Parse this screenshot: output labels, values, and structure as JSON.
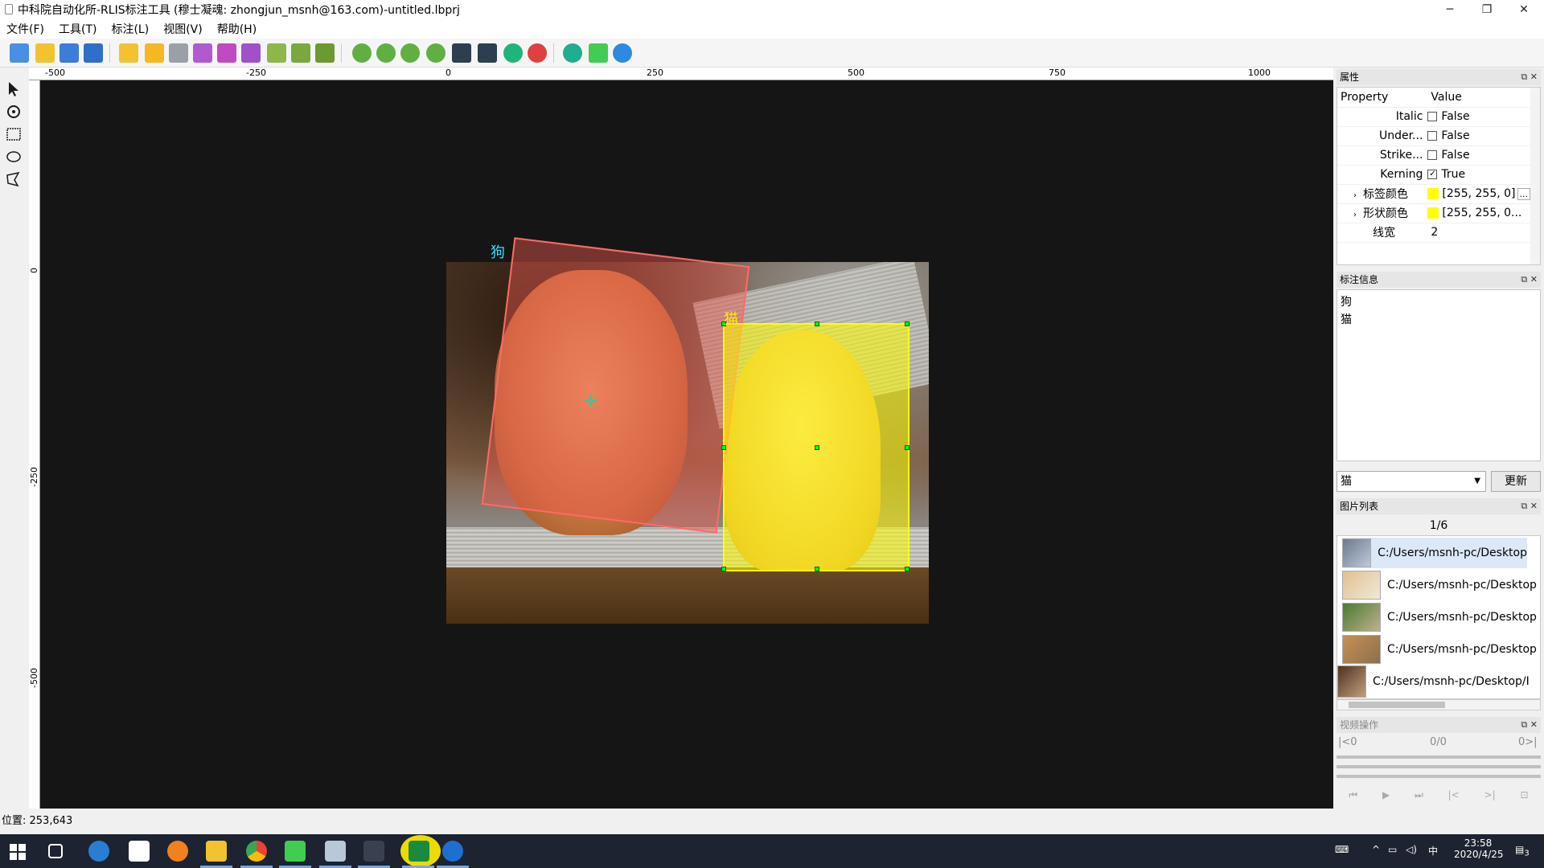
{
  "window": {
    "title": "中科院自动化所-RLIS标注工具 (穆士凝魂: zhongjun_msnh@163.com)-untitled.lbprj",
    "minimize_glyph": "─",
    "restore_glyph": "❐",
    "close_glyph": "✕"
  },
  "menu": [
    "文件(F)",
    "工具(T)",
    "标注(L)",
    "视图(V)",
    "帮助(H)"
  ],
  "toolbar_icons": [
    "new-file-icon",
    "open-file-icon",
    "save-icon",
    "save-as-icon",
    "open-folder-icon",
    "add-folder-icon",
    "export-icon",
    "add-layer-icon",
    "delete-layer-icon",
    "layers-icon",
    "copy-icon",
    "cut-icon",
    "paste-icon",
    "zoom-in-icon",
    "zoom-out-icon",
    "zoom-fit-icon",
    "zoom-1to1-icon",
    "skip-back-icon",
    "skip-forward-icon",
    "play-icon",
    "stop-icon",
    "settings-icon",
    "qt-icon",
    "info-icon"
  ],
  "left_tools": [
    "pointer-icon",
    "rotate-icon",
    "rectangle-icon",
    "ellipse-icon",
    "polygon-icon"
  ],
  "hruler": [
    "-500",
    "-250",
    "0",
    "250",
    "500",
    "750",
    "1000"
  ],
  "vruler": [
    "0",
    "-250",
    "-500"
  ],
  "canvas": {
    "annotations": [
      {
        "label": "狗",
        "color": "#ff6a66",
        "label_color": "#33e0ff"
      },
      {
        "label": "猫",
        "color": "#ffff00",
        "label_color": "#ffee00"
      }
    ],
    "center_marker": "✛"
  },
  "properties_panel": {
    "title": "属性",
    "header_property": "Property",
    "header_value": "Value",
    "rows": [
      {
        "name": "Italic",
        "value": "False",
        "checked": false
      },
      {
        "name": "Under...",
        "value": "False",
        "checked": false
      },
      {
        "name": "Strike...",
        "value": "False",
        "checked": false
      },
      {
        "name": "Kerning",
        "value": "True",
        "checked": true
      },
      {
        "name": "标签颜色",
        "value": "[255, 255, 0]",
        "color": "#ffff00",
        "ellipsis": "..."
      },
      {
        "name": "形状颜色",
        "value": "[255, 255, 0...",
        "color": "#ffff00"
      },
      {
        "name": "线宽",
        "value": "2"
      }
    ]
  },
  "annotation_info_panel": {
    "title": "标注信息",
    "items": [
      "狗",
      "猫"
    ],
    "select_value": "猫",
    "update_button": "更新"
  },
  "image_list_panel": {
    "title": "图片列表",
    "counter": "1/6",
    "items": [
      "C:/Users/msnh-pc/Desktop",
      "C:/Users/msnh-pc/Desktop",
      "C:/Users/msnh-pc/Desktop",
      "C:/Users/msnh-pc/Desktop",
      "C:/Users/msnh-pc/Desktop/I"
    ]
  },
  "video_panel": {
    "title": "视频操作",
    "start": "|<0",
    "frames": "0/0",
    "end": "0>|"
  },
  "status": {
    "position": "位置: 253,643"
  },
  "taskbar": {
    "apps": [
      "start-icon",
      "task-view-icon",
      "edge-icon",
      "store-icon",
      "search-app-icon",
      "explorer-icon",
      "chrome-icon",
      "qt-creator-icon",
      "notepad-icon",
      "app-icon",
      "rlis-icon",
      "teamviewer-icon"
    ],
    "ime": "中",
    "time": "23:58",
    "date": "2020/4/25",
    "notification_count": "3"
  }
}
